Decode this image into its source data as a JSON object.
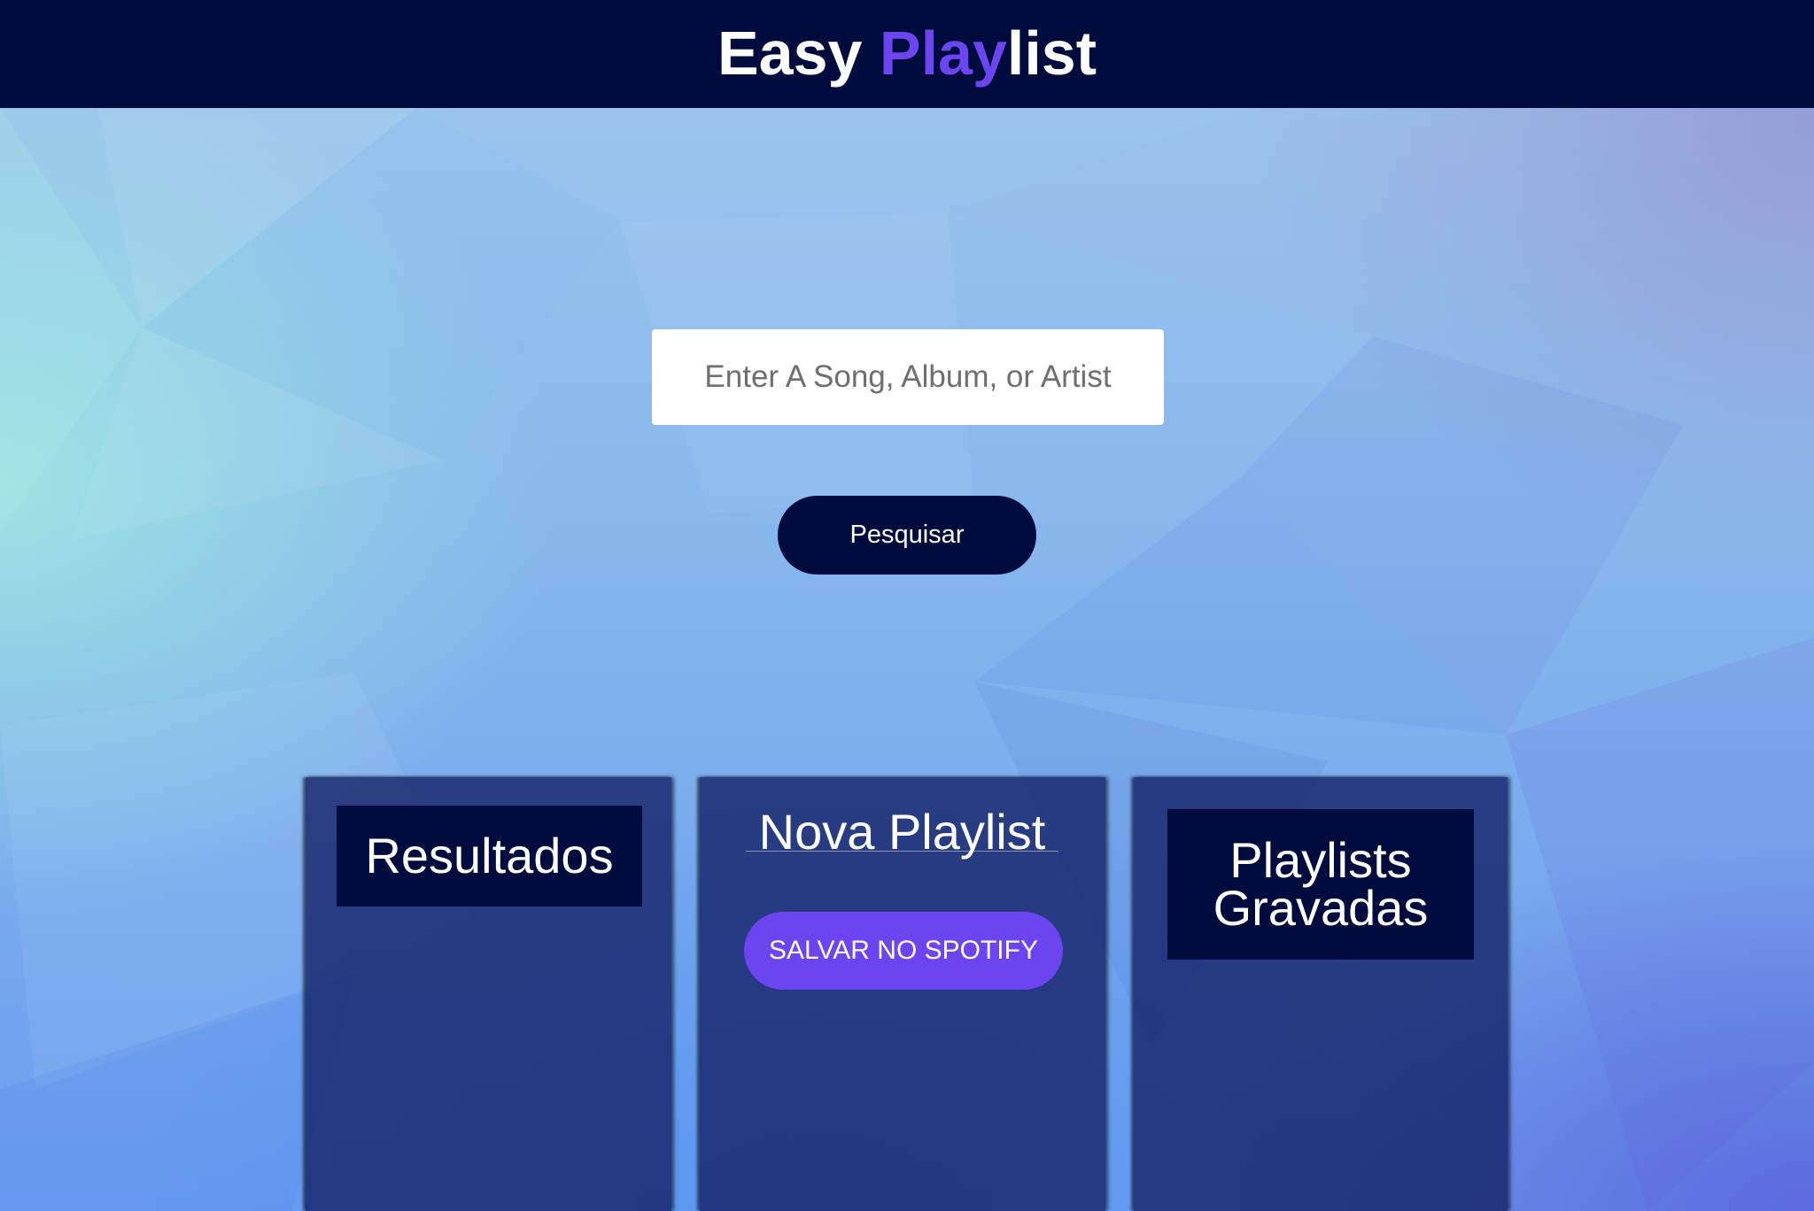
{
  "header": {
    "logo_part1": "Easy ",
    "logo_accent": "Play",
    "logo_part2": "list"
  },
  "search": {
    "placeholder": "Enter A Song, Album, or Artist",
    "value": "",
    "button_label": "Pesquisar"
  },
  "results": {
    "title": "Resultados"
  },
  "playlist": {
    "name": "Nova Playlist",
    "save_label": "SALVAR NO SPOTIFY"
  },
  "saved": {
    "title_line1": "Playlists",
    "title_line2": "Gravadas"
  },
  "colors": {
    "header_bg": "#000c3e",
    "accent": "#6c44f0",
    "panel_bg": "#1e2a6e"
  }
}
